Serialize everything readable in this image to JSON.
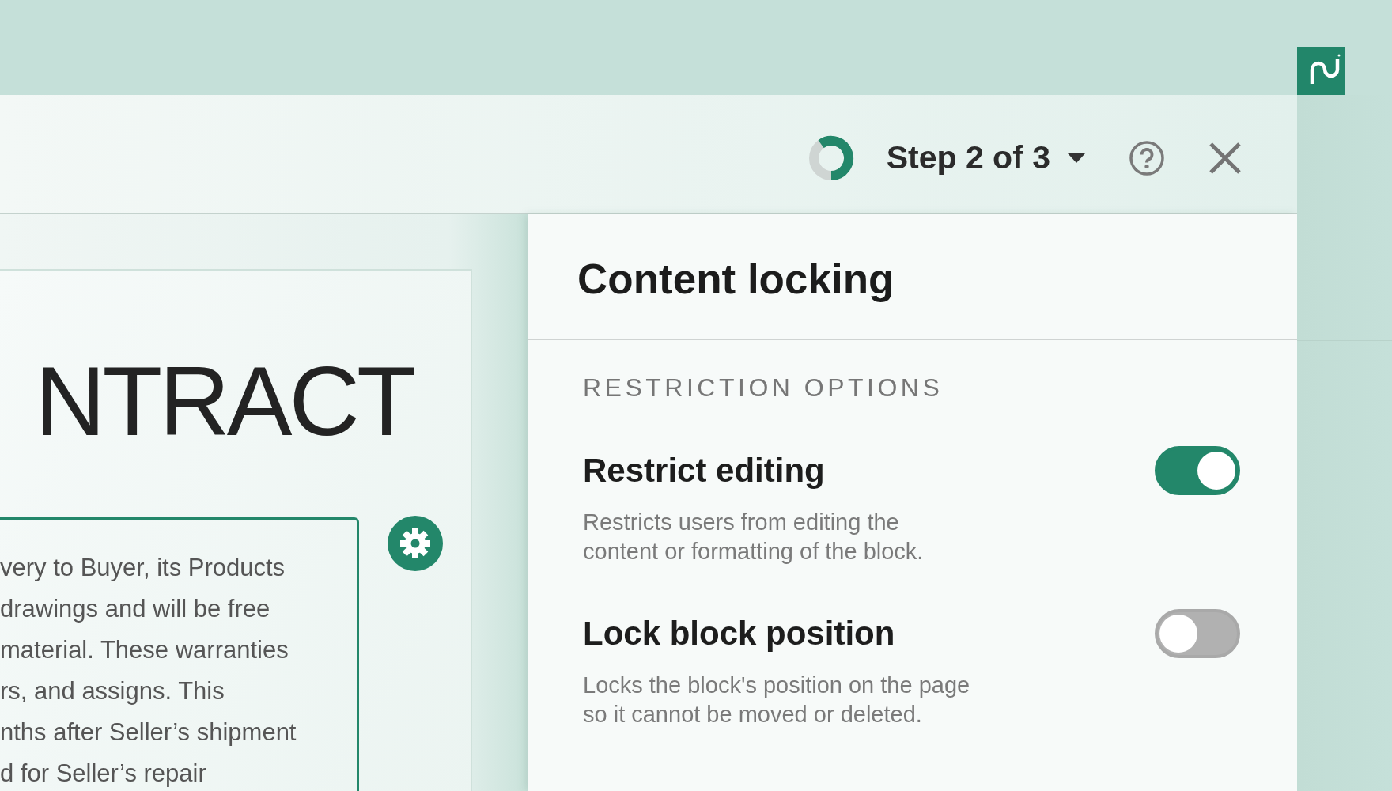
{
  "header": {
    "progress": {
      "level": 0.6
    },
    "step_label": "Step 2 of 3"
  },
  "document": {
    "heading": "NTRACT",
    "lines": [
      "very to Buyer, its Products",
      "drawings and will be free",
      "material. These warranties",
      "rs, and assigns. This",
      "nths after Seller’s shipment",
      "d for Seller’s repair"
    ]
  },
  "panel": {
    "title": "Content locking",
    "section_label": "RESTRICTION OPTIONS",
    "options": [
      {
        "title": "Restrict editing",
        "description_lines": [
          "Restricts users from editing the",
          "content or formatting of the block."
        ],
        "on": true
      },
      {
        "title": "Lock block position",
        "description_lines": [
          "Locks the block's position on the page",
          "so it cannot be moved or deleted."
        ],
        "on": false
      }
    ]
  }
}
